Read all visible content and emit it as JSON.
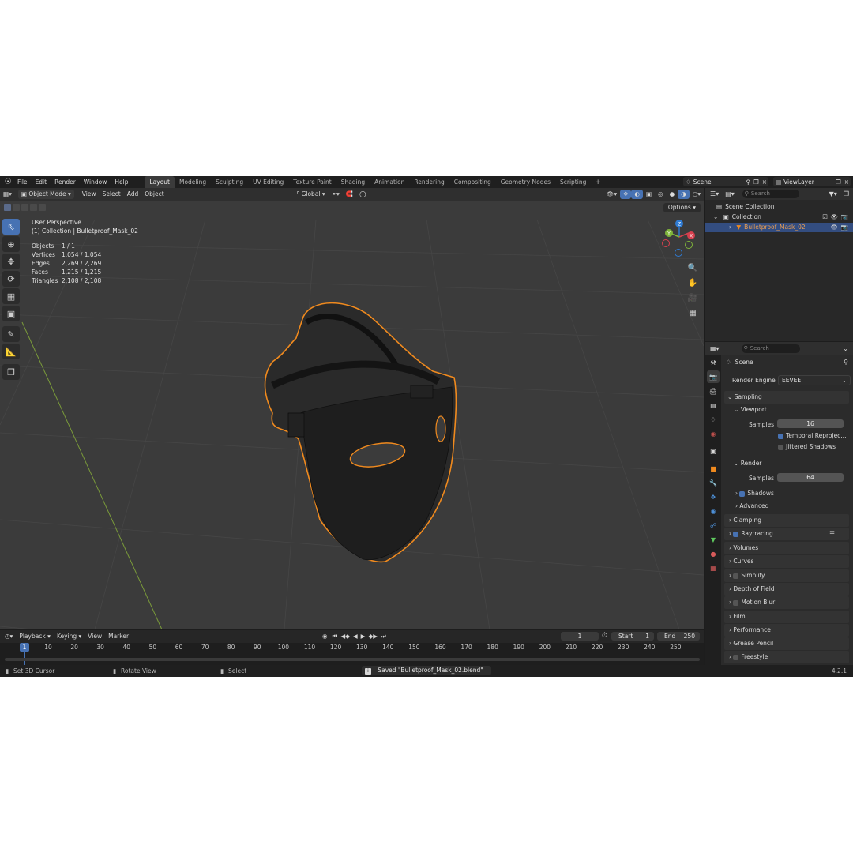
{
  "menu": [
    "File",
    "Edit",
    "Render",
    "Window",
    "Help"
  ],
  "workspaces": [
    {
      "label": "Layout",
      "active": true
    },
    {
      "label": "Modeling"
    },
    {
      "label": "Sculpting"
    },
    {
      "label": "UV Editing"
    },
    {
      "label": "Texture Paint"
    },
    {
      "label": "Shading"
    },
    {
      "label": "Animation"
    },
    {
      "label": "Rendering"
    },
    {
      "label": "Compositing"
    },
    {
      "label": "Geometry Nodes"
    },
    {
      "label": "Scripting"
    }
  ],
  "scene_name": "Scene",
  "view_layer": "ViewLayer",
  "viewport": {
    "mode": "Object Mode",
    "menus": [
      "View",
      "Select",
      "Add",
      "Object"
    ],
    "transform_orientation": "Global",
    "options_label": "Options",
    "perspective": "User Perspective",
    "collection_info": "(1) Collection | Bulletproof_Mask_02",
    "stats": [
      {
        "label": "Objects",
        "value": "1 / 1"
      },
      {
        "label": "Vertices",
        "value": "1,054 / 1,054"
      },
      {
        "label": "Edges",
        "value": "2,269 / 2,269"
      },
      {
        "label": "Faces",
        "value": "1,215 / 1,215"
      },
      {
        "label": "Triangles",
        "value": "2,108 / 2,108"
      }
    ],
    "gizmo_axes": {
      "z": "Z",
      "y": "Y",
      "x": "X"
    }
  },
  "timeline": {
    "menus": [
      "Playback",
      "Keying",
      "View",
      "Marker"
    ],
    "current_frame": "1",
    "start_label": "Start",
    "start": "1",
    "end_label": "End",
    "end": "250",
    "ruler": [
      "10",
      "20",
      "30",
      "40",
      "50",
      "60",
      "70",
      "80",
      "90",
      "100",
      "110",
      "120",
      "130",
      "140",
      "150",
      "160",
      "170",
      "180",
      "190",
      "200",
      "210",
      "220",
      "230",
      "240",
      "250"
    ],
    "playhead_label": "1"
  },
  "status": {
    "hint1": "Set 3D Cursor",
    "hint2": "Rotate View",
    "hint3": "Select",
    "message": "Saved \"Bulletproof_Mask_02.blend\"",
    "version": "4.2.1"
  },
  "outliner": {
    "search_placeholder": "Search",
    "scene_collection": "Scene Collection",
    "collection": "Collection",
    "object": "Bulletproof_Mask_02"
  },
  "properties": {
    "search_placeholder": "Search",
    "context": "Scene",
    "render_engine_label": "Render Engine",
    "render_engine": "EEVEE",
    "sampling": "Sampling",
    "viewport": "Viewport",
    "samples_label": "Samples",
    "viewport_samples": "16",
    "temporal": "Temporal Reprojec...",
    "jittered": "Jittered Shadows",
    "render": "Render",
    "render_samples": "64",
    "shadows": "Shadows",
    "advanced": "Advanced",
    "sections": [
      "Clamping",
      "Raytracing",
      "Volumes",
      "Curves",
      "Simplify",
      "Depth of Field",
      "Motion Blur",
      "Film",
      "Performance",
      "Grease Pencil",
      "Freestyle"
    ]
  },
  "colors": {
    "accent": "#4772b3",
    "selection_outline": "#f08a1e",
    "viewport_bg": "#3b3b3b"
  }
}
